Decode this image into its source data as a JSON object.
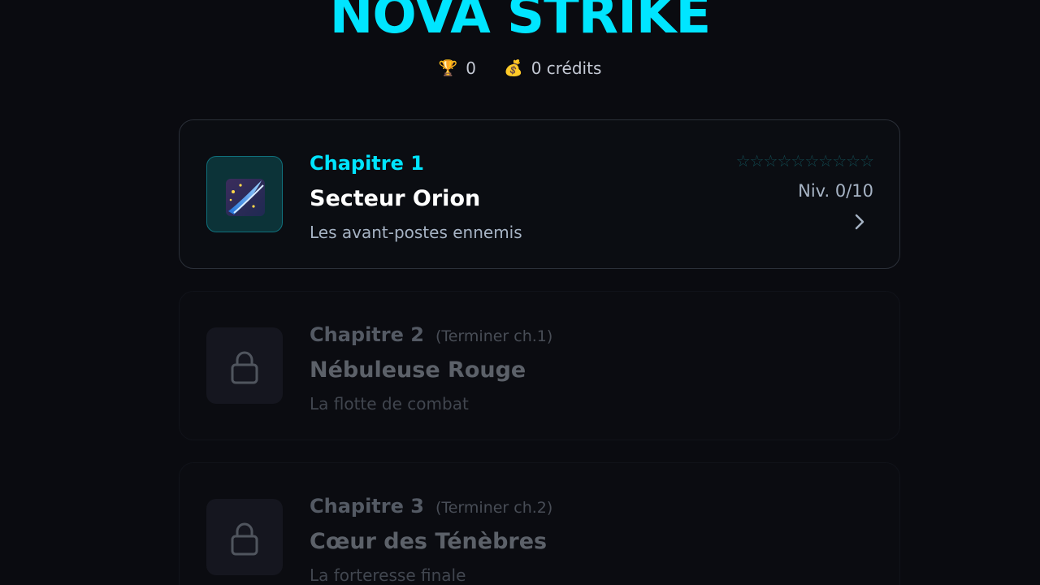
{
  "header": {
    "title": "NOVA STRIKE",
    "trophies_icon": "trophy-icon",
    "trophies_value": "0",
    "credits_icon": "money-bag-icon",
    "credits_value": "0 crédits"
  },
  "chapters": [
    {
      "chapter_label": "Chapitre 1",
      "requirement": "",
      "name": "Secteur Orion",
      "description": "Les avant-postes ennemis",
      "locked": false,
      "icon": "comet-icon",
      "stars_earned": 0,
      "stars_total": 10,
      "level_text": "Niv. 0/10"
    },
    {
      "chapter_label": "Chapitre 2",
      "requirement": "(Terminer ch.1)",
      "name": "Nébuleuse Rouge",
      "description": "La flotte de combat",
      "locked": true,
      "icon": "lock-icon"
    },
    {
      "chapter_label": "Chapitre 3",
      "requirement": "(Terminer ch.2)",
      "name": "Cœur des Ténèbres",
      "description": "La forteresse finale",
      "locked": true,
      "icon": "lock-icon"
    }
  ],
  "colors": {
    "accent": "#00e5ff",
    "background": "#0a0b10",
    "star_empty": "#11474e"
  }
}
